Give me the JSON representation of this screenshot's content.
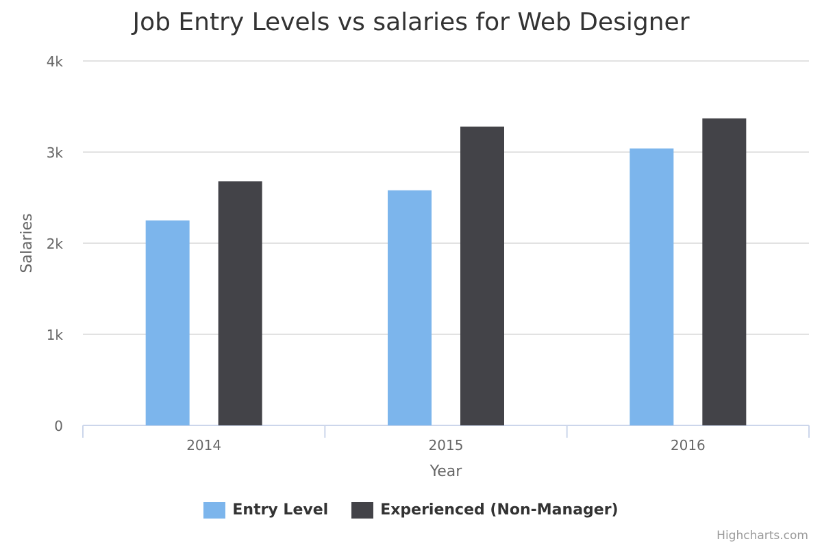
{
  "chart_data": {
    "type": "bar",
    "title": "Job Entry Levels vs salaries for Web Designer",
    "xlabel": "Year",
    "ylabel": "Salaries",
    "categories": [
      "2014",
      "2015",
      "2016"
    ],
    "series": [
      {
        "name": "Entry Level",
        "color": "#7cb5ec",
        "values": [
          2250,
          2580,
          3040
        ]
      },
      {
        "name": "Experienced (Non-Manager)",
        "color": "#434348",
        "values": [
          2680,
          3280,
          3370
        ]
      }
    ],
    "ylim": [
      0,
      4000
    ],
    "yticks": [
      0,
      1000,
      2000,
      3000,
      4000
    ],
    "ytick_labels": [
      "0",
      "1k",
      "2k",
      "3k",
      "4k"
    ],
    "grid": true,
    "legend_position": "bottom-center"
  },
  "credits": "Highcharts.com"
}
